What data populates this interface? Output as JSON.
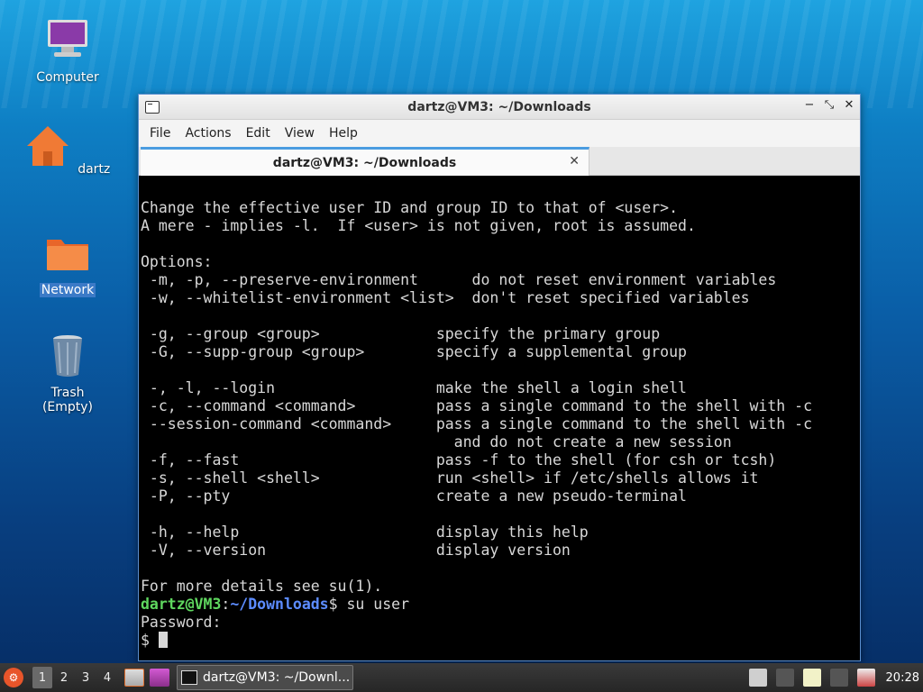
{
  "desktop": {
    "icons": [
      {
        "label": "Computer"
      },
      {
        "label": "dartz"
      },
      {
        "label": "Network"
      },
      {
        "label": "Trash (Empty)"
      }
    ]
  },
  "window": {
    "title": "dartz@VM3: ~/Downloads",
    "controls": {
      "minimize": "−",
      "maximize": "⤡",
      "close": "✕"
    },
    "menu": [
      "File",
      "Actions",
      "Edit",
      "View",
      "Help"
    ],
    "tab": {
      "label": "dartz@VM3: ~/Downloads",
      "close": "✕"
    }
  },
  "terminal": {
    "lines": [
      "",
      "Change the effective user ID and group ID to that of <user>.",
      "A mere - implies -l.  If <user> is not given, root is assumed.",
      "",
      "Options:",
      " -m, -p, --preserve-environment      do not reset environment variables",
      " -w, --whitelist-environment <list>  don't reset specified variables",
      "",
      " -g, --group <group>             specify the primary group",
      " -G, --supp-group <group>        specify a supplemental group",
      "",
      " -, -l, --login                  make the shell a login shell",
      " -c, --command <command>         pass a single command to the shell with -c",
      " --session-command <command>     pass a single command to the shell with -c",
      "                                   and do not create a new session",
      " -f, --fast                      pass -f to the shell (for csh or tcsh)",
      " -s, --shell <shell>             run <shell> if /etc/shells allows it",
      " -P, --pty                       create a new pseudo-terminal",
      "",
      " -h, --help                      display this help",
      " -V, --version                   display version",
      "",
      "For more details see su(1)."
    ],
    "prompt": {
      "userhost": "dartz@VM3",
      "sep": ":",
      "path": "~/Downloads",
      "symbol": "$ ",
      "command": "su user"
    },
    "password_line": "Password:",
    "final_prompt": "$ "
  },
  "taskbar": {
    "workspaces": [
      "1",
      "2",
      "3",
      "4"
    ],
    "task_label": "dartz@VM3: ~/Downl...",
    "clock": "20:28"
  }
}
